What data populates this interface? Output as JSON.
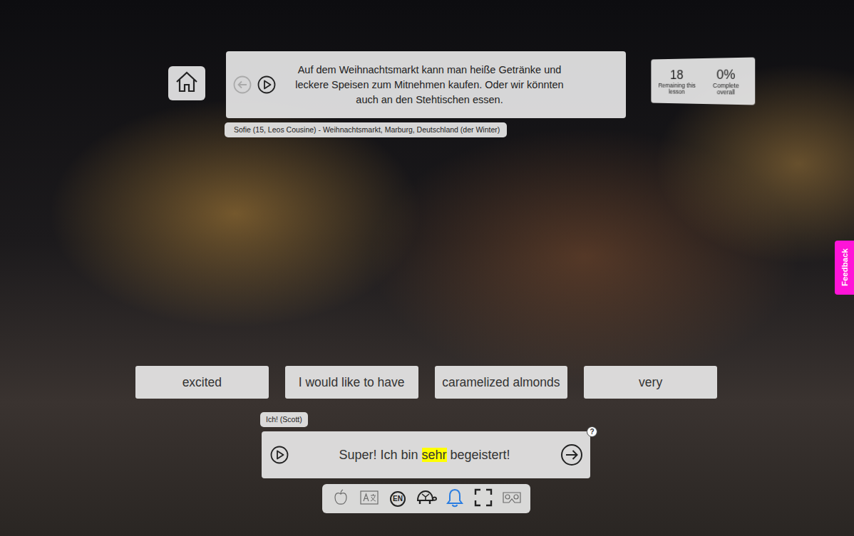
{
  "home": {},
  "lesson_bar": {
    "back": {
      "disabled": true
    },
    "play": {
      "disabled": false
    },
    "text": "Auf dem Weihnachtsmarkt kann man heiße Getränke und leckere Speisen zum Mitnehmen kaufen. Oder wir könnten auch an den Stehtischen essen."
  },
  "speaker": "Sofie (15, Leos Cousine) - Weihnachtsmarkt, Marburg, Deutschland (der Winter)",
  "stats": [
    {
      "value": "18",
      "label": "Remaining this lesson"
    },
    {
      "value": "0%",
      "label": "Complete overall"
    }
  ],
  "feedback": "Feedback",
  "options": [
    "excited",
    "I would like to have",
    "caramelized almonds",
    "very"
  ],
  "response": {
    "label": "Ich! (Scott)",
    "segments": [
      {
        "text": "Super! Ich bin ",
        "highlighted": false
      },
      {
        "text": "sehr",
        "highlighted": true
      },
      {
        "text": " begeistert!",
        "highlighted": false
      }
    ],
    "help": "?"
  },
  "toolbar": [
    {
      "kind": "apple",
      "active": false
    },
    {
      "kind": "translate",
      "active": false
    },
    {
      "kind": "language",
      "label": "EN",
      "active": false
    },
    {
      "kind": "turtle",
      "active": false
    },
    {
      "kind": "bell",
      "active": true
    },
    {
      "kind": "fullscreen",
      "active": false
    },
    {
      "kind": "vr",
      "active": false
    }
  ]
}
